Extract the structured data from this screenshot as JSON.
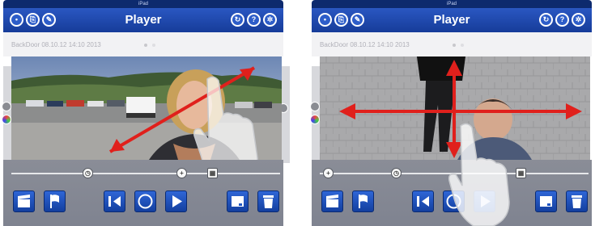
{
  "panels": [
    {
      "status": "iPad",
      "title": "Player",
      "camera_label": "BackDoor 08.10.12 14:10 2013"
    },
    {
      "status": "iPad",
      "title": "Player",
      "camera_label": "BackDoor 08.10.12 14:10 2013"
    }
  ],
  "colors": {
    "navbar": "#1f4bb0",
    "button": "#1f55c4",
    "arrow": "#e0201c",
    "controls": "#858893"
  },
  "icons": [
    "chat-icon",
    "export-icon",
    "settings-wrench-icon",
    "refresh-icon",
    "help-icon",
    "gear-icon",
    "clapperboard-icon",
    "flag-icon",
    "skip-back-icon",
    "circle-icon",
    "play-icon",
    "folder-icon",
    "trash-icon",
    "plus-icon",
    "clock-icon",
    "calendar-icon"
  ]
}
